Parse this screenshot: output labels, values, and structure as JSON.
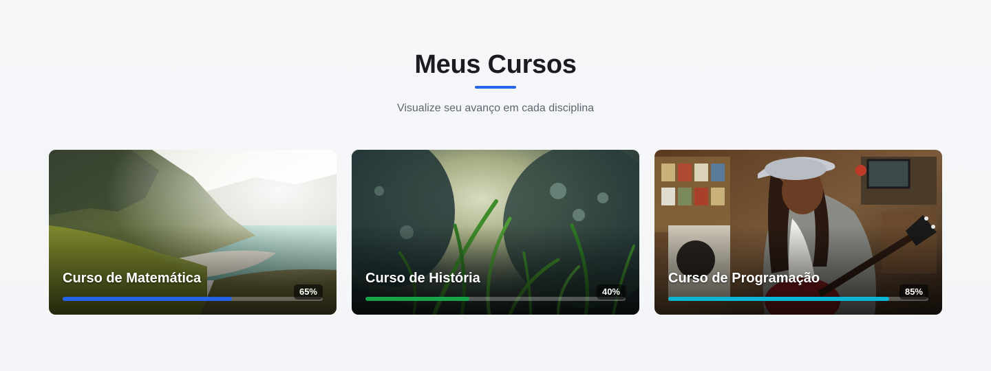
{
  "header": {
    "title": "Meus Cursos",
    "subtitle": "Visualize seu avanço em cada disciplina",
    "accent_color": "#2563eb"
  },
  "courses": [
    {
      "title": "Curso de Matemática",
      "progress_label": "65%",
      "progress": 0.65,
      "bar_color": "#2563eb",
      "image": "mountain-coast-landscape"
    },
    {
      "title": "Curso de História",
      "progress_label": "40%",
      "progress": 0.4,
      "bar_color": "#16a34a",
      "image": "grass-forest-closeup"
    },
    {
      "title": "Curso de Programação",
      "progress_label": "85%",
      "progress": 0.85,
      "bar_color": "#06b6d4",
      "image": "guitarist-in-record-store"
    }
  ]
}
